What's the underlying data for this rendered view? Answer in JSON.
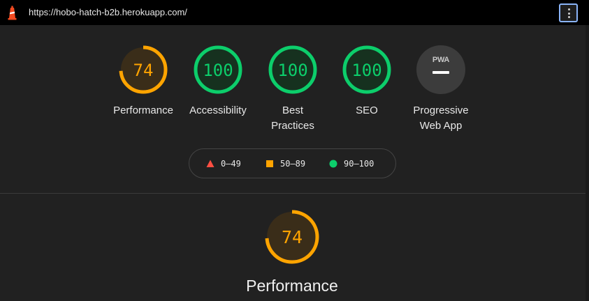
{
  "topbar": {
    "url": "https://hobo-hatch-b2b.herokuapp.com/",
    "logo_icon": "lighthouse-icon",
    "menu_icon": "vertical-dots-icon"
  },
  "gauges": [
    {
      "key": "performance",
      "score": "74",
      "value": 74,
      "label": "Performance",
      "status": "average",
      "color": "#ffa400"
    },
    {
      "key": "accessibility",
      "score": "100",
      "value": 100,
      "label": "Accessibility",
      "status": "pass",
      "color": "#0cce6b"
    },
    {
      "key": "best-practices",
      "score": "100",
      "value": 100,
      "label_line1": "Best",
      "label_line2": "Practices",
      "status": "pass",
      "color": "#0cce6b"
    },
    {
      "key": "seo",
      "score": "100",
      "value": 100,
      "label": "SEO",
      "status": "pass",
      "color": "#0cce6b"
    },
    {
      "key": "pwa",
      "badge": "PWA",
      "label_line1": "Progressive",
      "label_line2": "Web App",
      "icon": "pwa-badge-icon"
    }
  ],
  "legend": [
    {
      "range": "0–49",
      "shape": "triangle",
      "color": "#ff4e42"
    },
    {
      "range": "50–89",
      "shape": "square",
      "color": "#ffa400"
    },
    {
      "range": "90–100",
      "shape": "circle",
      "color": "#0cce6b"
    }
  ],
  "performance_section": {
    "score": "74",
    "value": 74,
    "title": "Performance",
    "color": "#ffa400"
  }
}
